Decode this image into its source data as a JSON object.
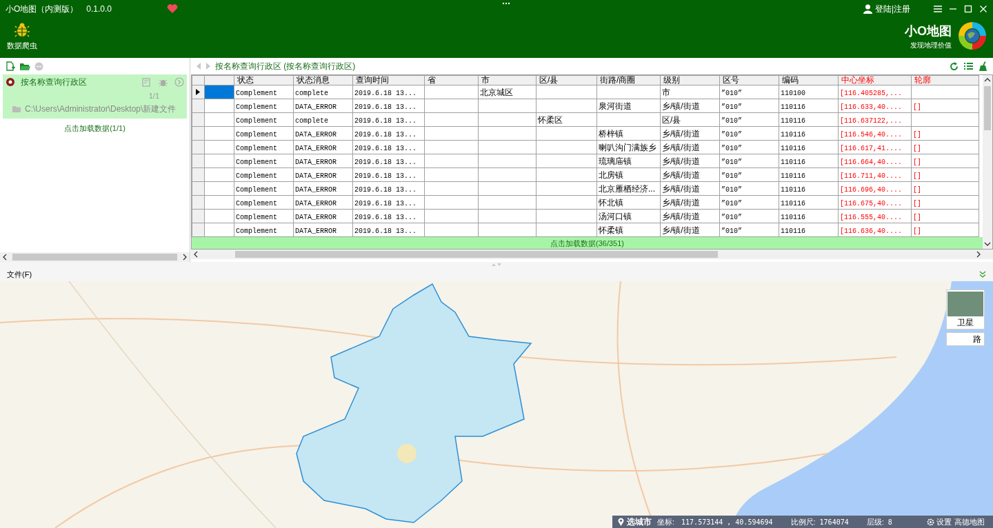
{
  "window": {
    "title": "小O地图（内测版）",
    "version": "0.1.0.0",
    "user": "登陆|注册"
  },
  "toolbar": [
    {
      "label": "数据爬虫"
    }
  ],
  "brand": {
    "name": "小O地图",
    "slogan": "发现地理价值"
  },
  "left_panel": {
    "query": {
      "title": "按名称查询行政区",
      "selected": true,
      "count": "1/1",
      "path": "C:\\Users\\Administrator\\Desktop\\新建文件"
    },
    "load_more": "点击加载数据(1/1)"
  },
  "breadcrumb": "按名称查询行政区 (按名称查询行政区)",
  "table": {
    "columns": [
      {
        "label": "状态",
        "highlighted": false
      },
      {
        "label": "状态消息",
        "highlighted": false
      },
      {
        "label": "查询时间",
        "highlighted": false
      },
      {
        "label": "省",
        "highlighted": false
      },
      {
        "label": "市",
        "highlighted": false
      },
      {
        "label": "区/县",
        "highlighted": false
      },
      {
        "label": "街路/商圈",
        "highlighted": false
      },
      {
        "label": "级别",
        "highlighted": false
      },
      {
        "label": "区号",
        "highlighted": false
      },
      {
        "label": "编码",
        "highlighted": false
      },
      {
        "label": "中心坐标",
        "highlighted": true
      },
      {
        "label": "轮廓",
        "highlighted": true
      }
    ],
    "rows": [
      {
        "selected": true,
        "cells": [
          "Complement",
          "complete",
          "2019.6.18 13...",
          null,
          "北京城区",
          null,
          null,
          "市",
          "”010”",
          "110100",
          "[116.405285,...",
          null
        ]
      },
      {
        "selected": false,
        "cells": [
          "Complement",
          "DATA_ERROR",
          "2019.6.18 13...",
          null,
          null,
          null,
          "泉河街道",
          "乡/镇/街道",
          "”010”",
          "110116",
          "[116.633,40....",
          "[]"
        ]
      },
      {
        "selected": false,
        "cells": [
          "Complement",
          "complete",
          "2019.6.18 13...",
          null,
          null,
          "怀柔区",
          null,
          "区/县",
          "”010”",
          "110116",
          "[116.637122,...",
          null
        ]
      },
      {
        "selected": false,
        "cells": [
          "Complement",
          "DATA_ERROR",
          "2019.6.18 13...",
          null,
          null,
          null,
          "桥梓镇",
          "乡/镇/街道",
          "”010”",
          "110116",
          "[116.546,40....",
          "[]"
        ]
      },
      {
        "selected": false,
        "cells": [
          "Complement",
          "DATA_ERROR",
          "2019.6.18 13...",
          null,
          null,
          null,
          "喇叭沟门满族乡",
          "乡/镇/街道",
          "”010”",
          "110116",
          "[116.617,41....",
          "[]"
        ]
      },
      {
        "selected": false,
        "cells": [
          "Complement",
          "DATA_ERROR",
          "2019.6.18 13...",
          null,
          null,
          null,
          "琉璃庙镇",
          "乡/镇/街道",
          "”010”",
          "110116",
          "[116.664,40....",
          "[]"
        ]
      },
      {
        "selected": false,
        "cells": [
          "Complement",
          "DATA_ERROR",
          "2019.6.18 13...",
          null,
          null,
          null,
          "北房镇",
          "乡/镇/街道",
          "”010”",
          "110116",
          "[116.711,40....",
          "[]"
        ]
      },
      {
        "selected": false,
        "cells": [
          "Complement",
          "DATA_ERROR",
          "2019.6.18 13...",
          null,
          null,
          null,
          "北京雁栖经济...",
          "乡/镇/街道",
          "”010”",
          "110116",
          "[116.696,40....",
          "[]"
        ]
      },
      {
        "selected": false,
        "cells": [
          "Complement",
          "DATA_ERROR",
          "2019.6.18 13...",
          null,
          null,
          null,
          "怀北镇",
          "乡/镇/街道",
          "”010”",
          "110116",
          "[116.675,40....",
          "[]"
        ]
      },
      {
        "selected": false,
        "cells": [
          "Complement",
          "DATA_ERROR",
          "2019.6.18 13...",
          null,
          null,
          null,
          "汤河口镇",
          "乡/镇/街道",
          "”010”",
          "110116",
          "[116.555,40....",
          "[]"
        ]
      },
      {
        "selected": false,
        "cells": [
          "Complement",
          "DATA_ERROR",
          "2019.6.18 13...",
          null,
          null,
          null,
          "怀柔镇",
          "乡/镇/街道",
          "”010”",
          "110116",
          "[116.636,40....",
          "[]"
        ]
      }
    ],
    "load_more": "点击加载数据(36/351)"
  },
  "menu": [
    "文件(F)"
  ],
  "map": {
    "layers": [
      {
        "label": "卫星",
        "kind": "satellite"
      },
      {
        "label": "路",
        "kind": "road"
      }
    ],
    "status": {
      "city": "选城市",
      "coord_label": "坐标:",
      "coord": "117.573144 , 40.594694",
      "scale_label": "比例尺:",
      "scale": "1764074",
      "zoom_label": "层级:",
      "zoom": "8",
      "settings": "设置",
      "provider": "高德地图"
    }
  }
}
